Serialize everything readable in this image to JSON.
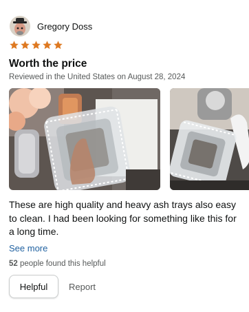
{
  "review": {
    "author": {
      "name": "Gregory Doss",
      "avatar_icon": "profile-avatar"
    },
    "rating": {
      "value": 5,
      "max": 5,
      "color": "#de7921"
    },
    "title": "Worth the price",
    "meta": "Reviewed in the United States on August 28, 2024",
    "photos": [
      {
        "icon": "glass-ash-tray-photo"
      },
      {
        "icon": "glass-ash-tray-photo"
      }
    ],
    "body": "These are high quality and heavy ash trays also easy to clean. I had been looking for something like this for a long time.",
    "see_more": "See more",
    "helpful": {
      "count": "52",
      "suffix": "people found this helpful"
    },
    "actions": {
      "helpful_label": "Helpful",
      "report_label": "Report"
    }
  }
}
